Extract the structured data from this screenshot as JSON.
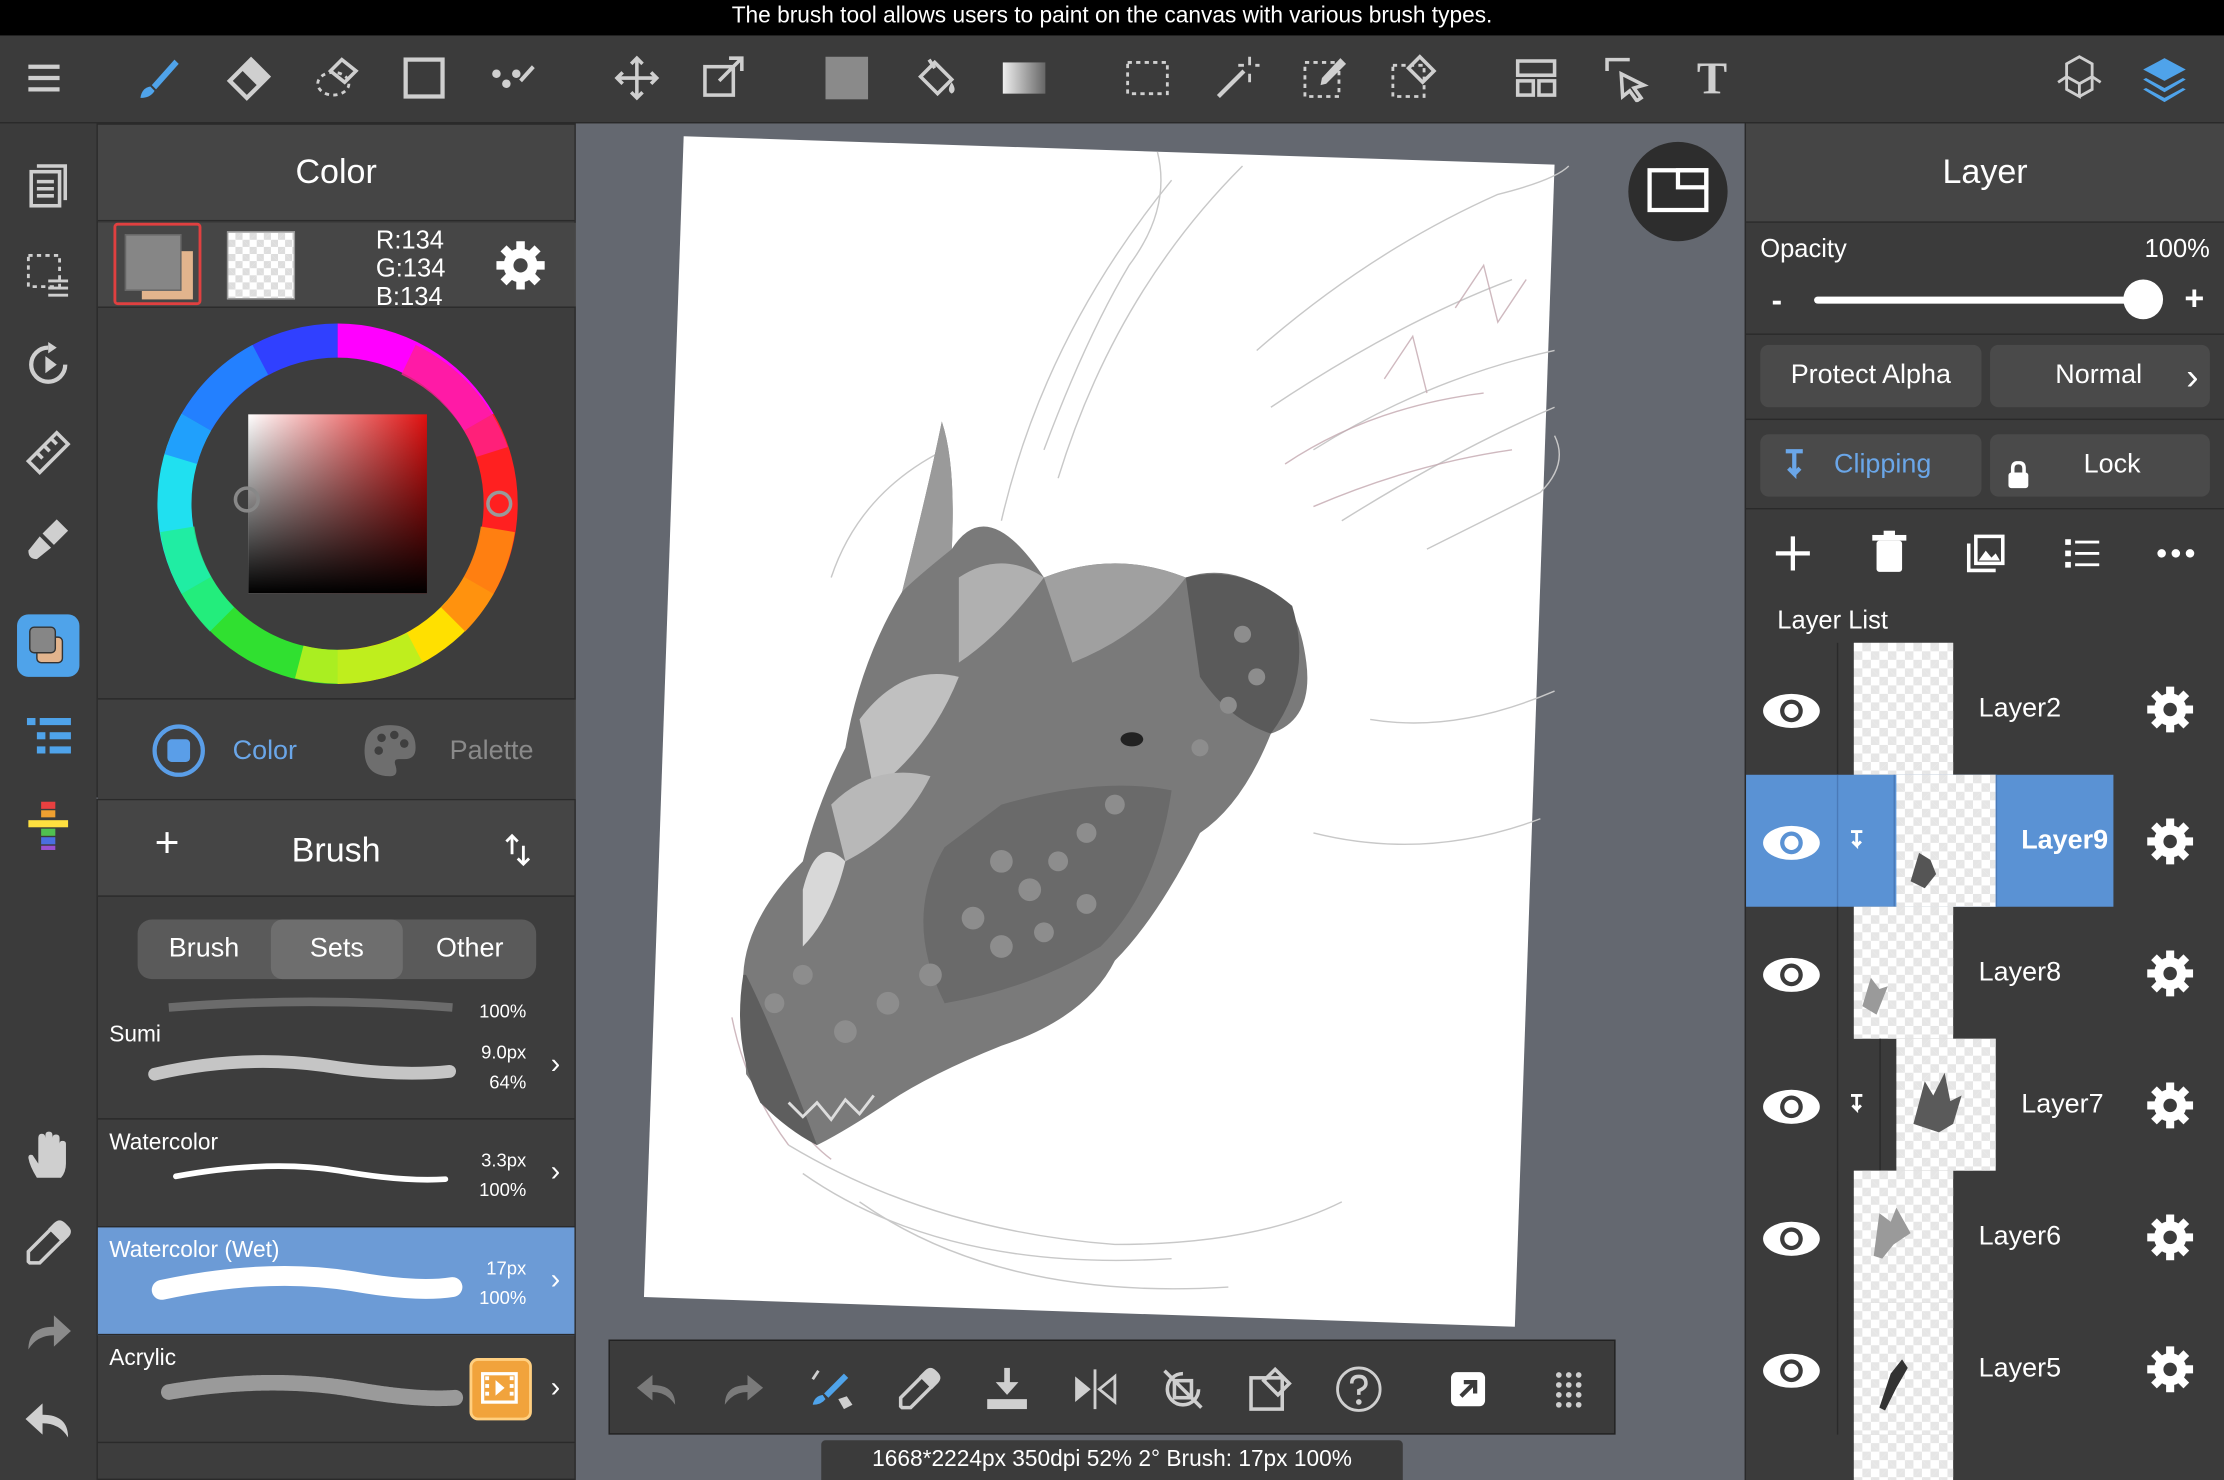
{
  "tooltip": "The brush tool allows users to paint on the canvas with various brush types.",
  "toolbar": {
    "tools": [
      "menu-icon",
      "brush-icon",
      "eraser-icon",
      "lasso-eraser-icon",
      "rectangle-icon",
      "dot-icon",
      "move-icon",
      "transform-icon",
      "fill-color-icon",
      "bucket-icon",
      "gradient-icon",
      "select-rect-icon",
      "magic-wand-icon",
      "select-pen-icon",
      "select-eraser-icon",
      "panel-icon",
      "select-arrow-icon",
      "text-icon",
      "3d-icon",
      "layers-icon"
    ],
    "text_tool": "T"
  },
  "color_panel": {
    "title": "Color",
    "r": "R:134",
    "g": "G:134",
    "b": "B:134",
    "tab_color": "Color",
    "tab_palette": "Palette",
    "accent": "#6aa6e8"
  },
  "brush_panel": {
    "add": "+",
    "title": "Brush",
    "segments": [
      "Brush",
      "Sets",
      "Other"
    ],
    "active_segment": "Sets",
    "top_partial_size": "100%",
    "items": [
      {
        "name": "Sumi",
        "size": "9.0px",
        "opacity": "64%"
      },
      {
        "name": "Watercolor",
        "size": "3.3px",
        "opacity": "100%"
      },
      {
        "name": "Watercolor (Wet)",
        "size": "17px",
        "opacity": "100%",
        "selected": true
      },
      {
        "name": "Acrylic",
        "size": "",
        "opacity": ""
      }
    ]
  },
  "status": "1668*2224px 350dpi 52% 2° Brush: 17px 100%",
  "layer_panel": {
    "title": "Layer",
    "opacity_label": "Opacity",
    "opacity_value": "100%",
    "opacity_level": 1.0,
    "minus": "-",
    "plus": "+",
    "protect_alpha": "Protect Alpha",
    "blend_mode": "Normal",
    "clipping": "Clipping",
    "lock": "Lock",
    "list_label": "Layer List",
    "layers": [
      {
        "name": "Layer2",
        "clipped": false,
        "selected": false
      },
      {
        "name": "Layer9",
        "clipped": true,
        "selected": true
      },
      {
        "name": "Layer8",
        "clipped": false,
        "selected": false
      },
      {
        "name": "Layer7",
        "clipped": true,
        "selected": false
      },
      {
        "name": "Layer6",
        "clipped": false,
        "selected": false
      },
      {
        "name": "Layer5",
        "clipped": false,
        "selected": false
      }
    ]
  }
}
